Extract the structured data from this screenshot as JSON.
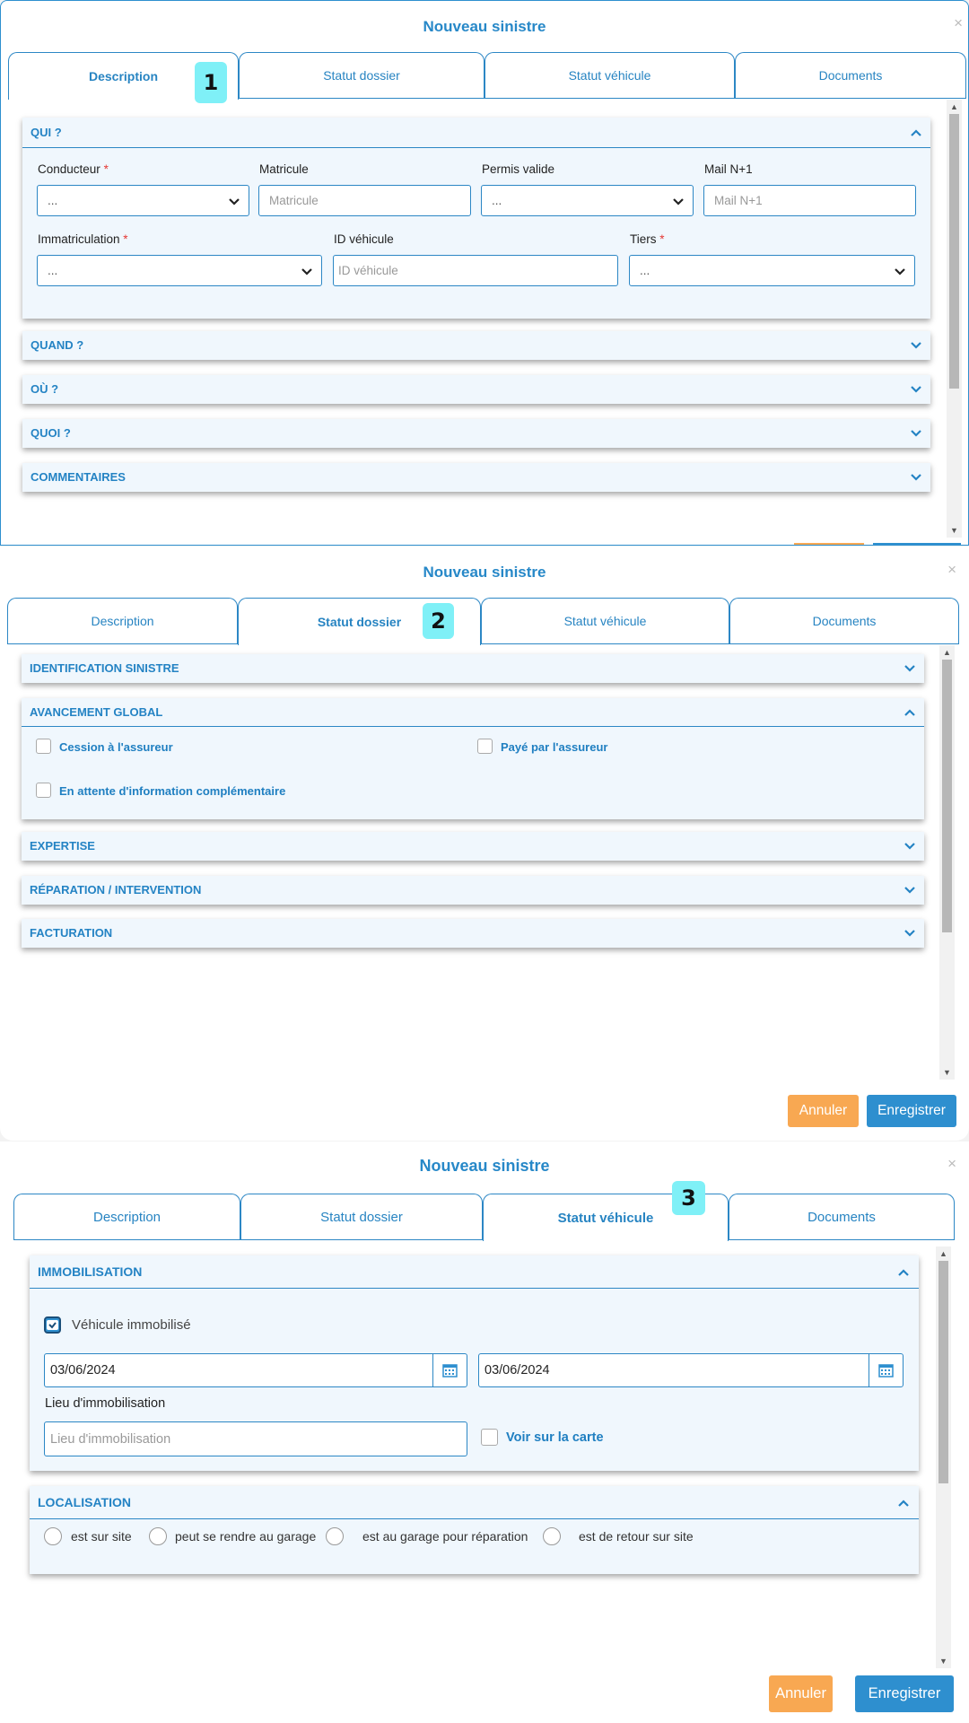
{
  "colors": {
    "primary": "#2e8fcf",
    "cancel": "#f8a852",
    "badge": "#7ff0f7",
    "panel_bg": "#f0f7fd"
  },
  "modal1": {
    "title": "Nouveau sinistre",
    "close": "×",
    "badge": "1",
    "tabs": [
      "Description",
      "Statut dossier",
      "Statut véhicule",
      "Documents"
    ],
    "active_tab": "Description",
    "qui": {
      "header": "QUI ?",
      "conducteur": {
        "label": "Conducteur",
        "required": "*",
        "value": "..."
      },
      "matricule": {
        "label": "Matricule",
        "placeholder": "Matricule"
      },
      "permis": {
        "label": "Permis valide",
        "value": "..."
      },
      "mail": {
        "label": "Mail N+1",
        "placeholder": "Mail N+1"
      },
      "immatriculation": {
        "label": "Immatriculation",
        "required": "*",
        "value": "..."
      },
      "id_vehicule": {
        "label": "ID véhicule",
        "placeholder": "ID véhicule"
      },
      "tiers": {
        "label": "Tiers",
        "required": "*",
        "value": "..."
      }
    },
    "sections": [
      "QUAND ?",
      "OÙ ?",
      "QUOI ?",
      "COMMENTAIRES"
    ]
  },
  "modal2": {
    "title": "Nouveau sinistre",
    "close": "×",
    "badge": "2",
    "tabs": [
      "Description",
      "Statut dossier",
      "Statut véhicule",
      "Documents"
    ],
    "active_tab": "Statut dossier",
    "identification": "IDENTIFICATION SINISTRE",
    "avancement": {
      "header": "AVANCEMENT GLOBAL",
      "cession": "Cession à l'assureur",
      "paye": "Payé par l'assureur",
      "attente": "En attente d'information complémentaire"
    },
    "sections": [
      "EXPERTISE",
      "RÉPARATION / INTERVENTION",
      "FACTURATION"
    ],
    "cancel": "Annuler",
    "save": "Enregistrer"
  },
  "modal3": {
    "title": "Nouveau sinistre",
    "close": "×",
    "badge": "3",
    "tabs": [
      "Description",
      "Statut dossier",
      "Statut véhicule",
      "Documents"
    ],
    "active_tab": "Statut véhicule",
    "immobilisation": {
      "header": "IMMOBILISATION",
      "checkbox": "Véhicule immobilisé",
      "checked": true,
      "date_start": "03/06/2024",
      "date_end": "03/06/2024",
      "lieu_label": "Lieu d'immobilisation",
      "lieu_placeholder": "Lieu d'immobilisation",
      "voir_carte": "Voir sur la carte"
    },
    "localisation": {
      "header": "LOCALISATION",
      "options": [
        "est sur site",
        "peut se rendre au garage",
        "est au garage pour réparation",
        "est de retour sur site"
      ]
    },
    "cancel": "Annuler",
    "save": "Enregistrer"
  }
}
